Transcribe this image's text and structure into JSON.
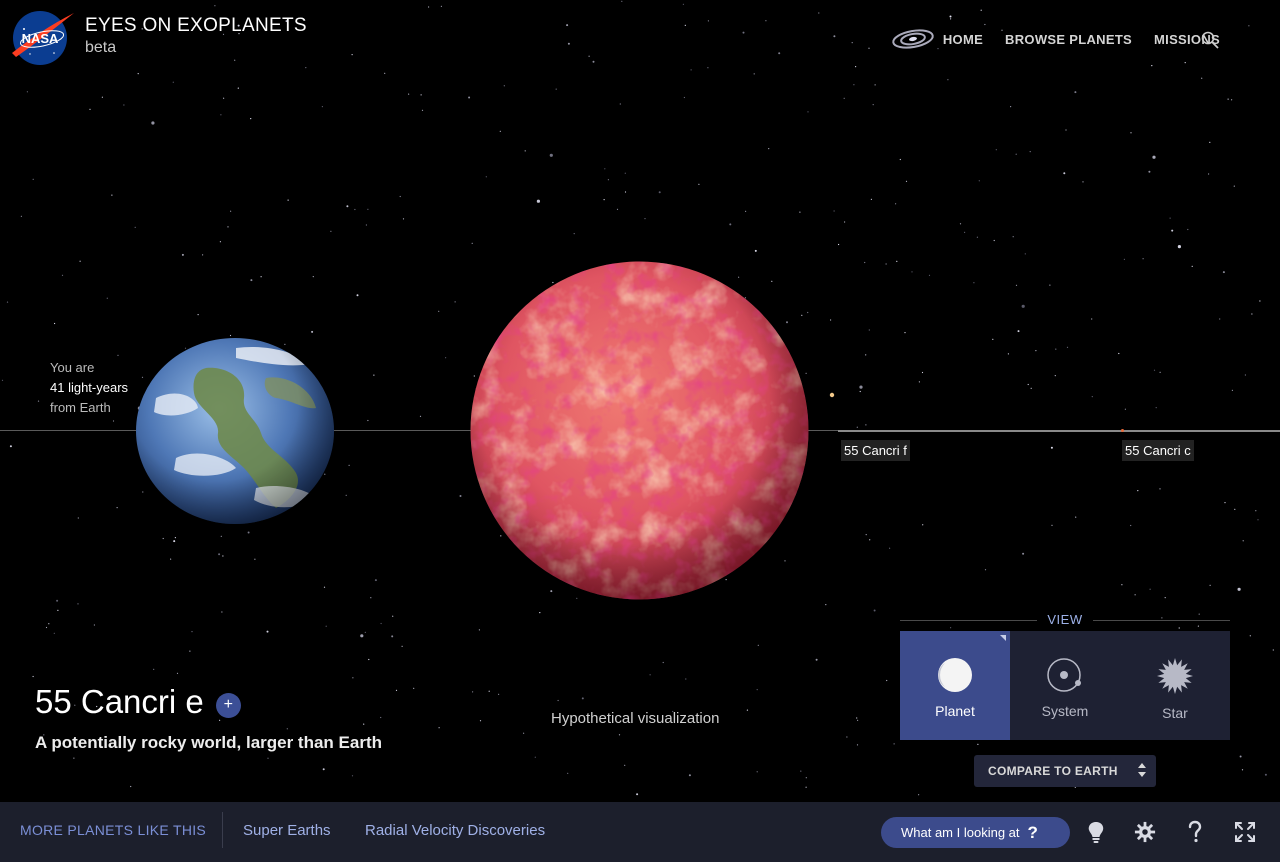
{
  "header": {
    "title": "EYES ON EXOPLANETS",
    "subtitle": "beta",
    "logo_text": "NASA",
    "nav": {
      "home": "HOME",
      "browse": "BROWSE PLANETS",
      "missions": "MISSIONS"
    }
  },
  "distance": {
    "line1": "You are",
    "line2": "41 light-years",
    "line3": "from Earth"
  },
  "orbit_labels": {
    "f": "55 Cancri f",
    "c": "55 Cancri c"
  },
  "planet": {
    "name": "55 Cancri e",
    "plus_label": "+",
    "description": "A potentially rocky world, larger than Earth",
    "visualization_note": "Hypothetical visualization"
  },
  "view_panel": {
    "title": "VIEW",
    "options": [
      {
        "label": "Planet",
        "icon": "planet-icon",
        "selected": true
      },
      {
        "label": "System",
        "icon": "system-icon",
        "selected": false
      },
      {
        "label": "Star",
        "icon": "star-icon",
        "selected": false
      }
    ]
  },
  "compare": {
    "label": "COMPARE TO EARTH"
  },
  "bottom_bar": {
    "more_label": "MORE PLANETS LIKE THIS",
    "links": [
      "Super Earths",
      "Radial Velocity Discoveries"
    ],
    "what_label": "What am I looking at",
    "what_q": "?",
    "icons": [
      "lightbulb-icon",
      "gear-icon",
      "help-icon",
      "fullscreen-icon"
    ]
  },
  "colors": {
    "accent": "#3c4b8c",
    "link": "#9fb0e6",
    "bar_bg": "#1c1f2c",
    "panel_bg": "#1e2133"
  }
}
